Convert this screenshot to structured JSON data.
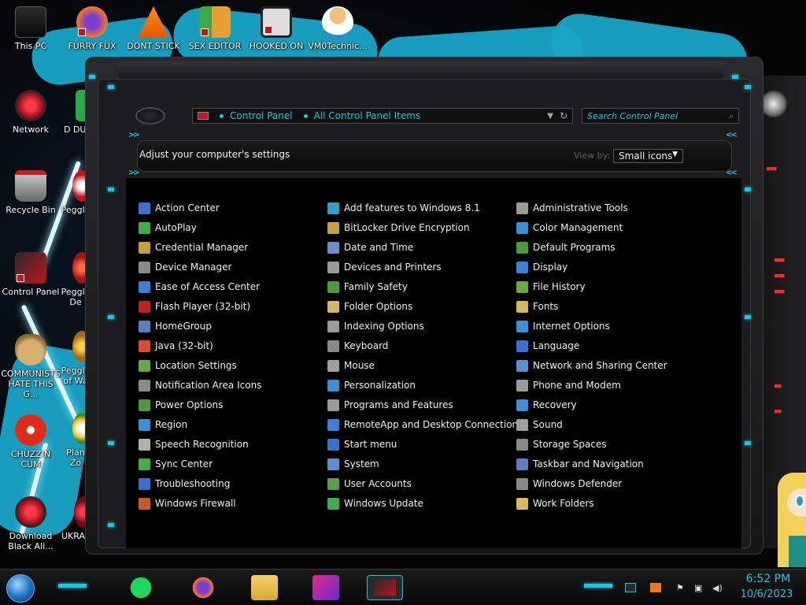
{
  "desktop": {
    "icons": [
      {
        "label": "This PC"
      },
      {
        "label": "FURRY FUX"
      },
      {
        "label": "DONT STICK"
      },
      {
        "label": "SEX EDITOR"
      },
      {
        "label": "HOOKED ON"
      },
      {
        "label": "VM0Technic..."
      },
      {
        "label": "Network"
      },
      {
        "label": "Recycle Bin"
      },
      {
        "label": "Control Panel"
      },
      {
        "label": "COMMUNISTS HATE THIS G..."
      },
      {
        "label": "CHUZZIN CUM"
      },
      {
        "label": "Download Black Ali..."
      },
      {
        "label": "D DUM"
      },
      {
        "label": "Peggle"
      },
      {
        "label": "Peggle De"
      },
      {
        "label": "Peggle of Wa"
      },
      {
        "label": "Plan Zo"
      },
      {
        "label": "UKRAINE"
      }
    ]
  },
  "window": {
    "address": {
      "crumbs": [
        "Control Panel",
        "All Control Panel Items"
      ]
    },
    "search_placeholder": "Search Control Panel",
    "header_title": "Adjust your computer's settings",
    "view_by_label": "View by:",
    "view_by_value": "Small icons",
    "columns": [
      [
        {
          "label": "Action Center",
          "icon": "flag-icon",
          "color": "#3b6fd6"
        },
        {
          "label": "AutoPlay",
          "icon": "autoplay-icon",
          "color": "#3fae4a"
        },
        {
          "label": "Credential Manager",
          "icon": "vault-icon",
          "color": "#c9a040"
        },
        {
          "label": "Device Manager",
          "icon": "device-manager-icon",
          "color": "#8a8a8a"
        },
        {
          "label": "Ease of Access Center",
          "icon": "ease-of-access-icon",
          "color": "#3a7fd9"
        },
        {
          "label": "Flash Player (32-bit)",
          "icon": "flash-icon",
          "color": "#c0211e"
        },
        {
          "label": "HomeGroup",
          "icon": "homegroup-icon",
          "color": "#5a7fbf"
        },
        {
          "label": "Java (32-bit)",
          "icon": "java-icon",
          "color": "#d94f2a"
        },
        {
          "label": "Location Settings",
          "icon": "location-icon",
          "color": "#6ba83d"
        },
        {
          "label": "Notification Area Icons",
          "icon": "notification-icon",
          "color": "#8a8a8a"
        },
        {
          "label": "Power Options",
          "icon": "power-icon",
          "color": "#4d9a3b"
        },
        {
          "label": "Region",
          "icon": "region-icon",
          "color": "#3a8fd9"
        },
        {
          "label": "Speech Recognition",
          "icon": "microphone-icon",
          "color": "#b0b0b0"
        },
        {
          "label": "Sync Center",
          "icon": "sync-icon",
          "color": "#3fae4a"
        },
        {
          "label": "Troubleshooting",
          "icon": "troubleshoot-icon",
          "color": "#3a6fd0"
        },
        {
          "label": "Windows Firewall",
          "icon": "firewall-icon",
          "color": "#c65a2a"
        }
      ],
      [
        {
          "label": "Add features to Windows 8.1",
          "icon": "add-features-icon",
          "color": "#2f9fd0"
        },
        {
          "label": "BitLocker Drive Encryption",
          "icon": "bitlocker-icon",
          "color": "#c9a040"
        },
        {
          "label": "Date and Time",
          "icon": "clock-icon",
          "color": "#6a8fd0"
        },
        {
          "label": "Devices and Printers",
          "icon": "printer-icon",
          "color": "#9a9a9a"
        },
        {
          "label": "Family Safety",
          "icon": "family-safety-icon",
          "color": "#4d9a3b"
        },
        {
          "label": "Folder Options",
          "icon": "folder-options-icon",
          "color": "#d8b860"
        },
        {
          "label": "Indexing Options",
          "icon": "indexing-icon",
          "color": "#9a9a9a"
        },
        {
          "label": "Keyboard",
          "icon": "keyboard-icon",
          "color": "#8a8a8a"
        },
        {
          "label": "Mouse",
          "icon": "mouse-icon",
          "color": "#a0a0a0"
        },
        {
          "label": "Personalization",
          "icon": "personalization-icon",
          "color": "#3a8fd9"
        },
        {
          "label": "Programs and Features",
          "icon": "programs-icon",
          "color": "#9a9a9a"
        },
        {
          "label": "RemoteApp and Desktop Connections",
          "icon": "remoteapp-icon",
          "color": "#3a7fd9"
        },
        {
          "label": "Start menu",
          "icon": "start-menu-icon",
          "color": "#3a6fd0"
        },
        {
          "label": "System",
          "icon": "system-icon",
          "color": "#5a8fd0"
        },
        {
          "label": "User Accounts",
          "icon": "user-accounts-icon",
          "color": "#5aa04a"
        },
        {
          "label": "Windows Update",
          "icon": "windows-update-icon",
          "color": "#3fae4a"
        }
      ],
      [
        {
          "label": "Administrative Tools",
          "icon": "admin-tools-icon",
          "color": "#9a9a9a"
        },
        {
          "label": "Color Management",
          "icon": "color-management-icon",
          "color": "#3a8fd9"
        },
        {
          "label": "Default Programs",
          "icon": "default-programs-icon",
          "color": "#4d9a3b"
        },
        {
          "label": "Display",
          "icon": "display-icon",
          "color": "#3a7fd9"
        },
        {
          "label": "File History",
          "icon": "file-history-icon",
          "color": "#6ba83d"
        },
        {
          "label": "Fonts",
          "icon": "fonts-icon",
          "color": "#d8b860"
        },
        {
          "label": "Internet Options",
          "icon": "internet-options-icon",
          "color": "#3a8fd9"
        },
        {
          "label": "Language",
          "icon": "language-icon",
          "color": "#3a6fd0"
        },
        {
          "label": "Network and Sharing Center",
          "icon": "network-icon",
          "color": "#5a8fd0"
        },
        {
          "label": "Phone and Modem",
          "icon": "phone-modem-icon",
          "color": "#9a9a9a"
        },
        {
          "label": "Recovery",
          "icon": "recovery-icon",
          "color": "#3a8fd9"
        },
        {
          "label": "Sound",
          "icon": "sound-icon",
          "color": "#a0a0a0"
        },
        {
          "label": "Storage Spaces",
          "icon": "storage-spaces-icon",
          "color": "#8a8a8a"
        },
        {
          "label": "Taskbar and Navigation",
          "icon": "taskbar-icon",
          "color": "#5a7fbf"
        },
        {
          "label": "Windows Defender",
          "icon": "defender-icon",
          "color": "#8a8a8a"
        },
        {
          "label": "Work Folders",
          "icon": "work-folders-icon",
          "color": "#d8b860"
        }
      ]
    ]
  },
  "taskbar": {
    "time": "6:52 PM",
    "date": "10/6/2023",
    "apps": [
      "spotify-icon",
      "firefox-icon",
      "file-explorer-icon",
      "media-icon",
      "control-panel-icon"
    ]
  },
  "colors": {
    "accent": "#19c6e6",
    "background": "#000000"
  }
}
